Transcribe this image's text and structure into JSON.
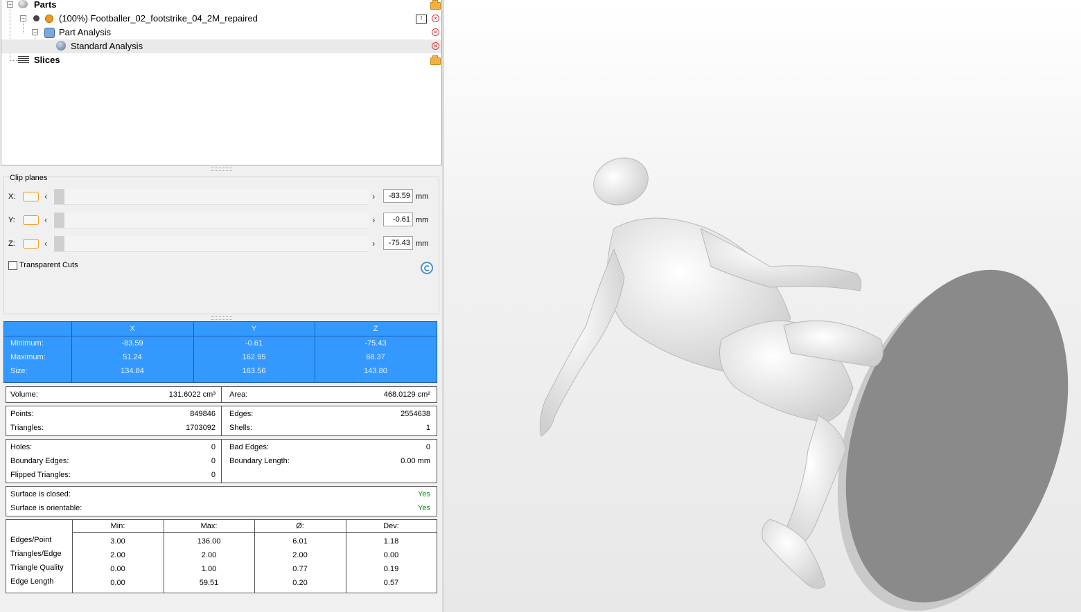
{
  "tree": {
    "parts_label": "Parts",
    "part_name": "(100%) Footballer_02_footstrike_04_2M_repaired",
    "analysis_label": "Part Analysis",
    "standard_label": "Standard Analysis",
    "slices_label": "Slices"
  },
  "clip": {
    "title": "Clip planes",
    "axes": [
      {
        "label": "X:",
        "value": "-83.59",
        "unit": "mm"
      },
      {
        "label": "Y:",
        "value": "-0.61",
        "unit": "mm"
      },
      {
        "label": "Z:",
        "value": "-75.43",
        "unit": "mm"
      }
    ],
    "transparent_cuts": "Transparent Cuts"
  },
  "bounds": {
    "headers": [
      "X",
      "Y",
      "Z"
    ],
    "rows": [
      {
        "label": "Minimum:",
        "values": [
          "-83.59",
          "-0.61",
          "-75.43"
        ]
      },
      {
        "label": "Maximum:",
        "values": [
          "51.24",
          "162.95",
          "68.37"
        ]
      },
      {
        "label": "Size:",
        "values": [
          "134.84",
          "163.56",
          "143.80"
        ]
      }
    ]
  },
  "volume": {
    "label": "Volume:",
    "value": "131.6022 cm³",
    "area_label": "Area:",
    "area_value": "468.0129 cm²"
  },
  "mesh": {
    "points_label": "Points:",
    "points": "849846",
    "triangles_label": "Triangles:",
    "triangles": "1703092",
    "edges_label": "Edges:",
    "edges": "2554638",
    "shells_label": "Shells:",
    "shells": "1"
  },
  "errors": {
    "holes_label": "Holes:",
    "holes": "0",
    "boundary_edges_label": "Boundary Edges:",
    "boundary_edges": "0",
    "flipped_label": "Flipped Triangles:",
    "flipped": "0",
    "bad_edges_label": "Bad Edges:",
    "bad_edges": "0",
    "boundary_length_label": "Boundary Length:",
    "boundary_length": "0.00 mm"
  },
  "surface": {
    "closed_label": "Surface is closed:",
    "closed": "Yes",
    "orientable_label": "Surface is orientable:",
    "orientable": "Yes"
  },
  "stats": {
    "headers": [
      "Min:",
      "Max:",
      "Ø:",
      "Dev:"
    ],
    "rows": [
      {
        "label": "Edges/Point",
        "values": [
          "3.00",
          "136.00",
          "6.01",
          "1.18"
        ]
      },
      {
        "label": "Triangles/Edge",
        "values": [
          "2.00",
          "2.00",
          "2.00",
          "0.00"
        ]
      },
      {
        "label": "Triangle Quality",
        "values": [
          "0.00",
          "1.00",
          "0.77",
          "0.19"
        ]
      },
      {
        "label": "Edge Length",
        "values": [
          "0.00",
          "59.51",
          "0.20",
          "0.57"
        ]
      }
    ]
  },
  "colors": {
    "selection": "#3399ff",
    "accent_orange": "#f39a1d",
    "ok_green": "#0a8a0a",
    "model_grey": "#8a8a8a"
  }
}
